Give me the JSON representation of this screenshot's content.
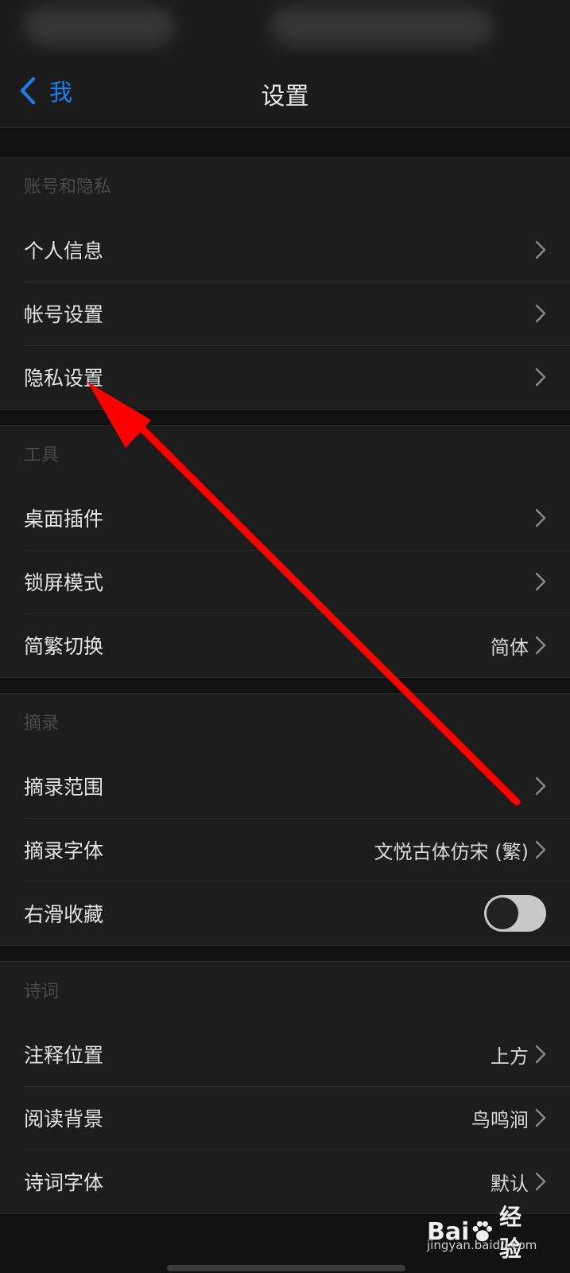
{
  "nav": {
    "back_label": "我",
    "title": "设置"
  },
  "sections": [
    {
      "header": "账号和隐私",
      "rows": [
        {
          "label": "个人信息",
          "value": ""
        },
        {
          "label": "帐号设置",
          "value": ""
        },
        {
          "label": "隐私设置",
          "value": ""
        }
      ]
    },
    {
      "header": "工具",
      "rows": [
        {
          "label": "桌面插件",
          "value": ""
        },
        {
          "label": "锁屏模式",
          "value": ""
        },
        {
          "label": "简繁切换",
          "value": "简体"
        }
      ]
    },
    {
      "header": "摘录",
      "rows": [
        {
          "label": "摘录范围",
          "value": ""
        },
        {
          "label": "摘录字体",
          "value": "文悦古体仿宋 (繁)"
        },
        {
          "label": "右滑收藏",
          "toggle": "off"
        }
      ]
    },
    {
      "header": "诗词",
      "rows": [
        {
          "label": "注释位置",
          "value": "上方"
        },
        {
          "label": "阅读背景",
          "value": "鸟鸣涧"
        },
        {
          "label": "诗词字体",
          "value": "默认"
        }
      ]
    }
  ],
  "watermark": {
    "brand_left": "Bai",
    "brand_right": "经验",
    "url": "jingyan.baidu.com"
  },
  "colors": {
    "accent": "#1a7ff0",
    "annotation_arrow": "#ff0000",
    "background": "#111111",
    "cell": "#1d1d1d"
  }
}
